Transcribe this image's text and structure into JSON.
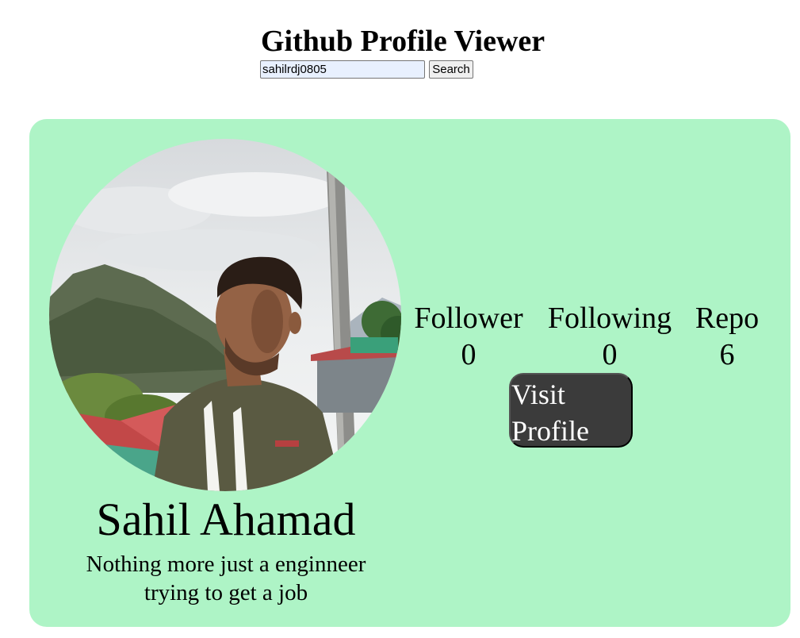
{
  "header": {
    "title": "Github Profile Viewer"
  },
  "search": {
    "value": "sahilrdj0805",
    "button_label": "Search"
  },
  "profile": {
    "name": "Sahil Ahamad",
    "bio": "Nothing more just a enginneer trying to get a job",
    "avatar_icon": "user-avatar-photo",
    "stats": {
      "followers_label": "Follower",
      "followers_value": "0",
      "following_label": "Following",
      "following_value": "0",
      "repos_label": "Repo",
      "repos_value": "6"
    },
    "visit_label": "Visit Profile"
  },
  "colors": {
    "card_background": "#aef4c6",
    "button_background": "#3b3b3b",
    "input_background": "#e8f0fe"
  }
}
